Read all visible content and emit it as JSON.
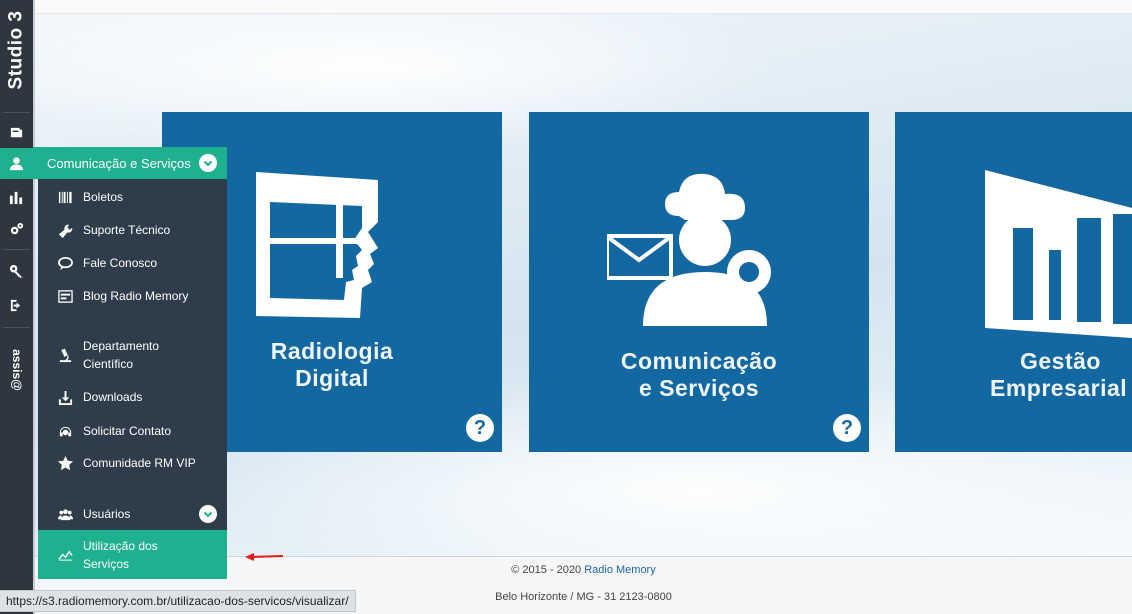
{
  "rail": {
    "brand": "Studio 3",
    "user": "assis@"
  },
  "menu": {
    "header_label": "Comunicação e Serviços",
    "items": [
      {
        "label": "Boletos"
      },
      {
        "label": "Suporte Técnico"
      },
      {
        "label": "Fale Conosco"
      },
      {
        "label": "Blog Radio Memory"
      },
      {
        "label": "Departamento Científico"
      },
      {
        "label": "Downloads"
      },
      {
        "label": "Solicitar Contato"
      },
      {
        "label": "Comunidade RM VIP"
      },
      {
        "label": "Usuários"
      },
      {
        "label": "Utilização dos Serviços"
      }
    ]
  },
  "tiles": [
    {
      "title_line1": "Radiologia",
      "title_line2": "Digital",
      "help": "?"
    },
    {
      "title_line1": "Comunicação",
      "title_line2": "e Serviços",
      "help": "?"
    },
    {
      "title_line1": "Gestão",
      "title_line2": "Empresarial"
    }
  ],
  "footer": {
    "copyright": "© 2015 - 2020",
    "company_link": "Radio Memory",
    "address": "Belo Horizonte / MG - 31 2123-0800"
  },
  "status_url": "https://s3.radiomemory.com.br/utilizacao-dos-servicos/visualizar/",
  "colors": {
    "rail": "#2f3640",
    "accent": "#1fb08f",
    "menu_bg": "#2f3d4b",
    "tile_bg": "#1468a1",
    "arrow": "#e21b1b"
  }
}
